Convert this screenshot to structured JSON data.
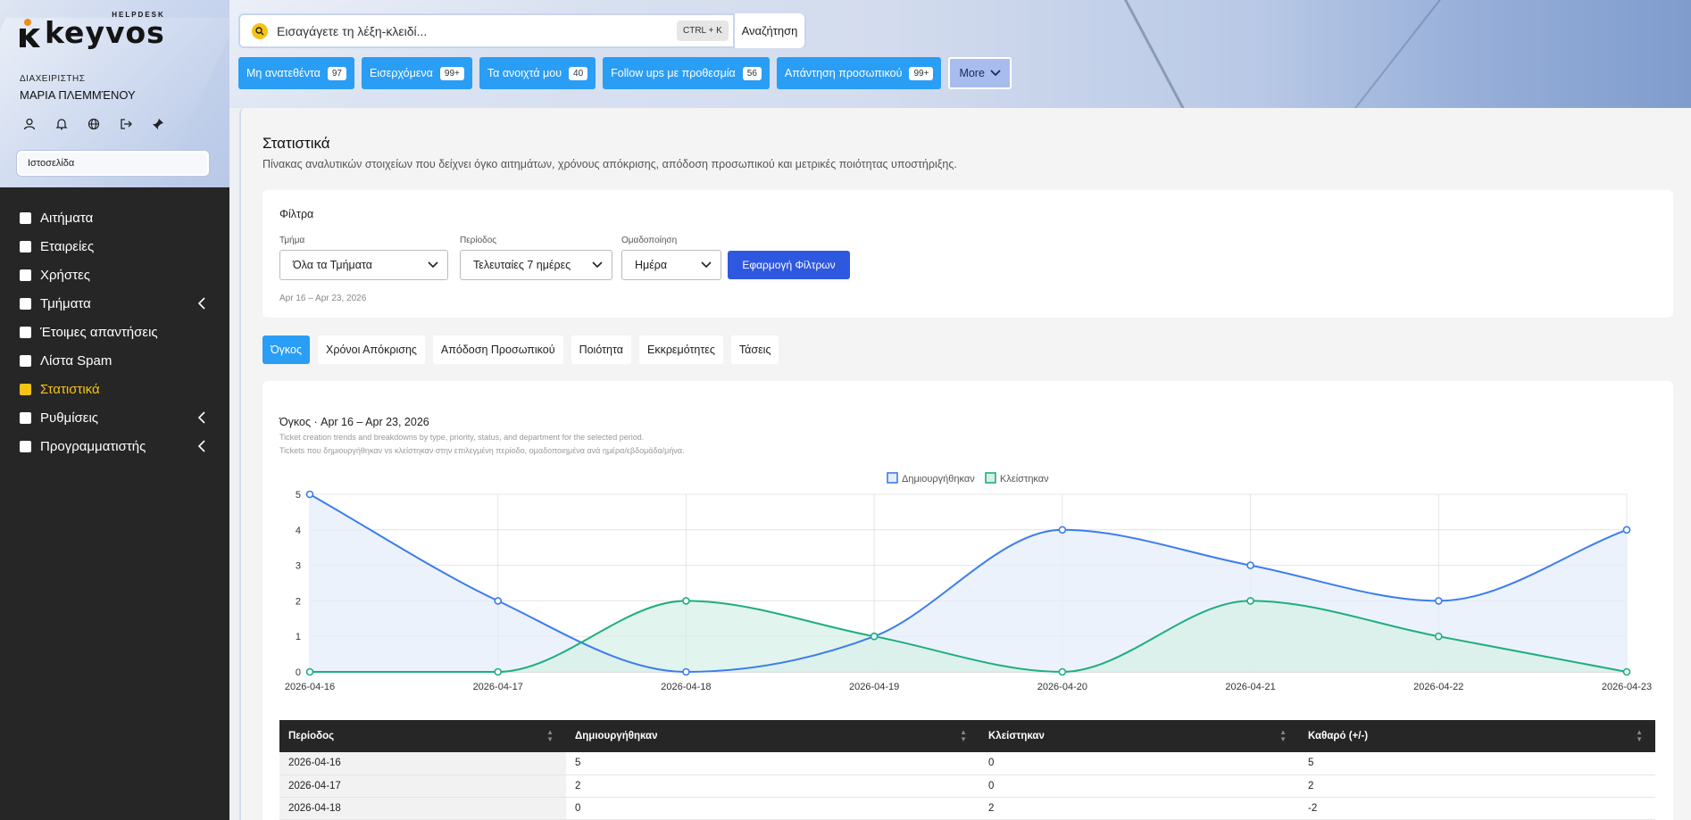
{
  "brand": {
    "name": "keyvos",
    "sub": "HELPDESK"
  },
  "user": {
    "role": "ΔΙΑΧΕΙΡΙΣΤΗΣ",
    "name": "ΜΑΡΙΑ ΠΛΕΜΜΈΝΟΥ",
    "site": "Ιστοσελίδα"
  },
  "user_icons": [
    "user-icon",
    "bell-icon",
    "globe-icon",
    "logout-icon",
    "pin-icon"
  ],
  "sidebar": {
    "items": [
      {
        "label": "Αιτήματα",
        "active": false,
        "submenu": false
      },
      {
        "label": "Εταιρείες",
        "active": false,
        "submenu": false
      },
      {
        "label": "Χρήστες",
        "active": false,
        "submenu": false
      },
      {
        "label": "Τμήματα",
        "active": false,
        "submenu": true
      },
      {
        "label": "Έτοιμες απαντήσεις",
        "active": false,
        "submenu": false
      },
      {
        "label": "Λίστα Spam",
        "active": false,
        "submenu": false
      },
      {
        "label": "Στατιστικά",
        "active": true,
        "submenu": false
      },
      {
        "label": "Ρυθμίσεις",
        "active": false,
        "submenu": true
      },
      {
        "label": "Προγραμματιστής",
        "active": false,
        "submenu": true
      }
    ]
  },
  "search": {
    "placeholder": "Εισαγάγετε τη λέξη-κλειδί...",
    "shortcut": "CTRL + K",
    "button": "Αναζήτηση"
  },
  "quick": {
    "buttons": [
      {
        "label": "Μη ανατεθέντα",
        "badge": "97"
      },
      {
        "label": "Εισερχόμενα",
        "badge": "99+"
      },
      {
        "label": "Τα ανοιχτά μου",
        "badge": "40"
      },
      {
        "label": "Follow ups με προθεσμία",
        "badge": "56"
      },
      {
        "label": "Απάντηση προσωπικού",
        "badge": "99+"
      }
    ],
    "more": "More"
  },
  "page": {
    "title": "Στατιστικά",
    "description": "Πίνακας αναλυτικών στοιχείων που δείχνει όγκο αιτημάτων, χρόνους απόκρισης, απόδοση προσωπικού και μετρικές ποιότητας υποστήριξης."
  },
  "filters": {
    "title": "Φίλτρα",
    "department": {
      "label": "Τμήμα",
      "value": "Όλα τα Τμήματα"
    },
    "period": {
      "label": "Περίοδος",
      "value": "Τελευταίες 7 ημέρες"
    },
    "grouping": {
      "label": "Ομαδοποίηση",
      "value": "Ημέρα"
    },
    "apply": "Εφαρμογή Φίλτρων",
    "range": "Apr 16 – Apr 23, 2026"
  },
  "tabs": [
    {
      "label": "Όγκος",
      "active": true
    },
    {
      "label": "Χρόνοι Απόκρισης",
      "active": false
    },
    {
      "label": "Απόδοση Προσωπικού",
      "active": false
    },
    {
      "label": "Ποιότητα",
      "active": false
    },
    {
      "label": "Εκκρεμότητες",
      "active": false
    },
    {
      "label": "Τάσεις",
      "active": false
    }
  ],
  "chart_card": {
    "title": "Όγκος · Apr 16 – Apr 23, 2026",
    "subtitle1": "Ticket creation trends and breakdowns by type, priority, status, and department for the selected period.",
    "subtitle2": "Tickets που δημιουργήθηκαν vs κλείστηκαν στην επιλεγμένη περίοδο, ομαδοποιημένα ανά ημέρα/εβδομάδα/μήνα."
  },
  "chart_data": {
    "type": "area",
    "x": [
      "2026-04-16",
      "2026-04-17",
      "2026-04-18",
      "2026-04-19",
      "2026-04-20",
      "2026-04-21",
      "2026-04-22",
      "2026-04-23"
    ],
    "series": [
      {
        "name": "Δημιουργήθηκαν",
        "values": [
          5,
          2,
          0,
          1,
          4,
          3,
          2,
          4
        ],
        "color": "#3b7ded",
        "fill": "#e6edfa"
      },
      {
        "name": "Κλείστηκαν",
        "values": [
          0,
          0,
          2,
          1,
          0,
          2,
          1,
          0
        ],
        "color": "#1fae7f",
        "fill": "#d7f0e7"
      }
    ],
    "ylim": [
      0,
      5
    ],
    "yticks": [
      0,
      1,
      2,
      3,
      4,
      5
    ],
    "grid": true,
    "legend": "top-center"
  },
  "table": {
    "headers": [
      "Περίοδος",
      "Δημιουργήθηκαν",
      "Κλείστηκαν",
      "Καθαρό (+/-)"
    ],
    "rows": [
      [
        "2026-04-16",
        "5",
        "0",
        "5"
      ],
      [
        "2026-04-17",
        "2",
        "0",
        "2"
      ],
      [
        "2026-04-18",
        "0",
        "2",
        "-2"
      ]
    ]
  }
}
